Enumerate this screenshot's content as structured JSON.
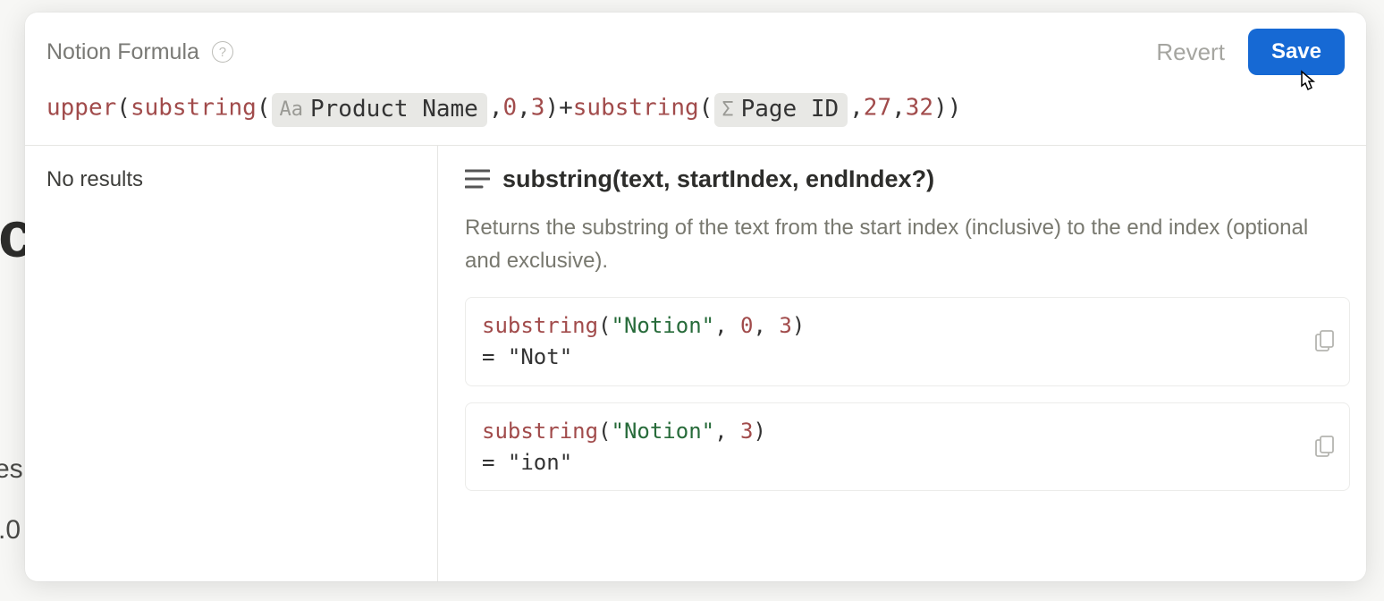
{
  "header": {
    "title": "Notion Formula",
    "help_glyph": "?",
    "revert_label": "Revert",
    "save_label": "Save"
  },
  "formula": {
    "fn_upper": "upper",
    "open1": "(",
    "fn_sub1": "substring",
    "open2": "(",
    "token1_icon": "Aa",
    "token1_label": "Product Name",
    "comma1": ",",
    "arg1a": "0",
    "comma2": ",",
    "arg1b": "3",
    "close2": ")",
    "plus": "+",
    "fn_sub2": "substring",
    "open3": "(",
    "token2_icon": "Σ",
    "token2_label": "Page ID",
    "comma3": ",",
    "arg2a": "27",
    "comma4": ",",
    "arg2b": "32",
    "close3": ")",
    "close1": ")"
  },
  "left": {
    "no_results": "No results"
  },
  "doc": {
    "signature": "substring(text, startIndex, endIndex?)",
    "description": "Returns the substring of the text from the start index (inclusive) to the end index (optional and exclusive).",
    "examples": [
      {
        "fn": "substring",
        "open": "(",
        "str": "\"Notion\"",
        "sep1": ", ",
        "a1": "0",
        "sep2": ", ",
        "a2": "3",
        "close": ")",
        "result": "= \"Not\""
      },
      {
        "fn": "substring",
        "open": "(",
        "str": "\"Notion\"",
        "sep1": ", ",
        "a1": "3",
        "sep2": "",
        "a2": "",
        "close": ")",
        "result": "= \"ion\""
      }
    ]
  },
  "background": {
    "c": "c",
    "es": "es",
    "zero": ".0"
  }
}
